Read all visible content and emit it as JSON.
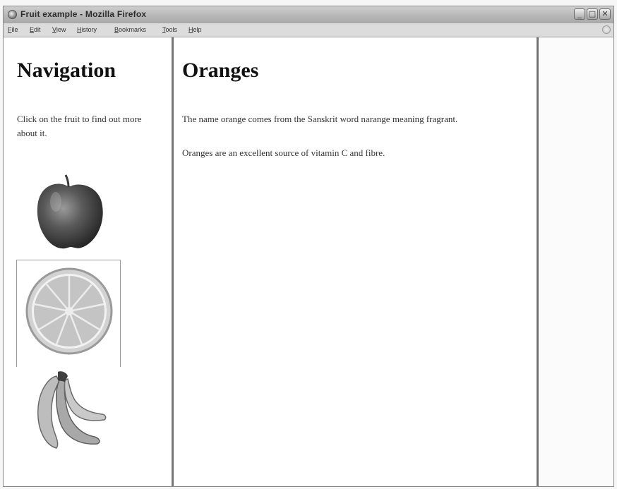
{
  "window": {
    "title": "Fruit example - Mozilla Firefox",
    "icon": "firefox-globe-icon"
  },
  "controls": {
    "minimize": "_",
    "maximize": "□",
    "close": "✕"
  },
  "menu": [
    {
      "label": "File",
      "accel": "F",
      "rest": "ile"
    },
    {
      "label": "Edit",
      "accel": "E",
      "rest": "dit"
    },
    {
      "label": "View",
      "accel": "V",
      "rest": "iew"
    },
    {
      "label": "History",
      "accel": "H",
      "rest": "istory"
    },
    {
      "label": "Bookmarks",
      "accel": "B",
      "rest": "ookmarks"
    },
    {
      "label": "Tools",
      "accel": "T",
      "rest": "ools"
    },
    {
      "label": "Help",
      "accel": "H",
      "rest": "elp"
    }
  ],
  "nav": {
    "heading": "Navigation",
    "text": "Click on the fruit to find out more about it.",
    "fruits": [
      {
        "name": "apple",
        "icon": "apple-image"
      },
      {
        "name": "orange",
        "icon": "orange-slice-image"
      },
      {
        "name": "banana",
        "icon": "banana-bunch-image"
      }
    ]
  },
  "main": {
    "heading": "Oranges",
    "paragraphs": [
      "The name orange comes from the Sanskrit word narange meaning fragrant.",
      "Oranges are an excellent source of vitamin C and fibre."
    ]
  },
  "colors": {
    "frame_divider": "#757575",
    "titlebar": "#b7b7b7",
    "menubar": "#dcdcdc"
  }
}
